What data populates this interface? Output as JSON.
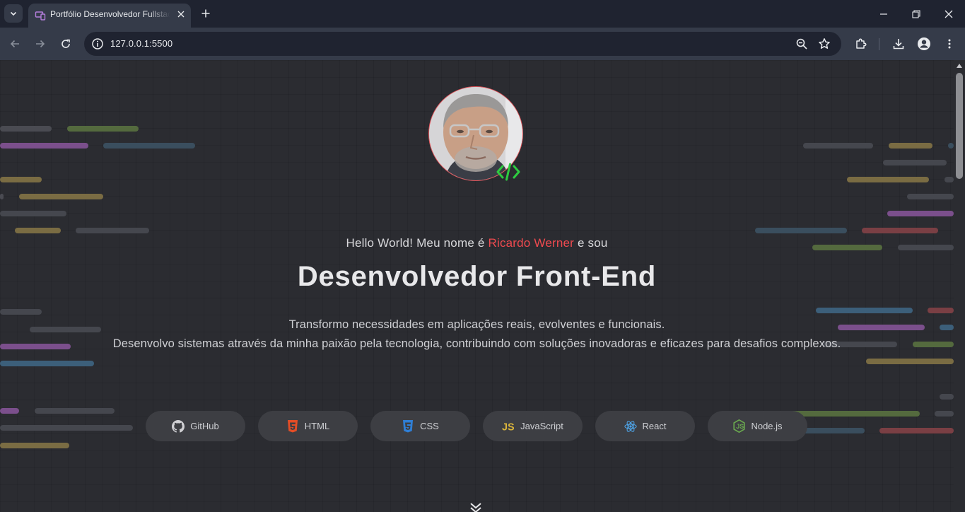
{
  "browser": {
    "tab_title": "Portfólio Desenvolvedor Fullstack",
    "url": "127.0.0.1:5500"
  },
  "hero": {
    "greeting_prefix": "Hello World! Meu nome é ",
    "greeting_name": "Ricardo Werner",
    "greeting_suffix": " e sou",
    "role": "Desenvolvedor Front-End",
    "description_line1": "Transformo necessidades em aplicações reais, evolventes e funcionais.",
    "description_line2": "Desenvolvo sistemas através da minha paixão pela tecnologia, contribuindo com soluções inovadoras e eficazes para desafios complexos."
  },
  "skills": [
    {
      "label": "GitHub",
      "icon": "github-icon",
      "color": "#d0d0d4"
    },
    {
      "label": "HTML",
      "icon": "html5-icon",
      "color": "#e44d26"
    },
    {
      "label": "CSS",
      "icon": "css3-icon",
      "color": "#2f7fd6"
    },
    {
      "label": "JavaScript",
      "icon": "js-icon",
      "color": "#d9b43b"
    },
    {
      "label": "React",
      "icon": "react-icon",
      "color": "#4ea3e6"
    },
    {
      "label": "Node.js",
      "icon": "nodejs-icon",
      "color": "#6aa84f"
    }
  ],
  "colors": {
    "accent": "#ef4a4f",
    "badge_green": "#2ecc40",
    "page_bg": "#2b2c31"
  }
}
